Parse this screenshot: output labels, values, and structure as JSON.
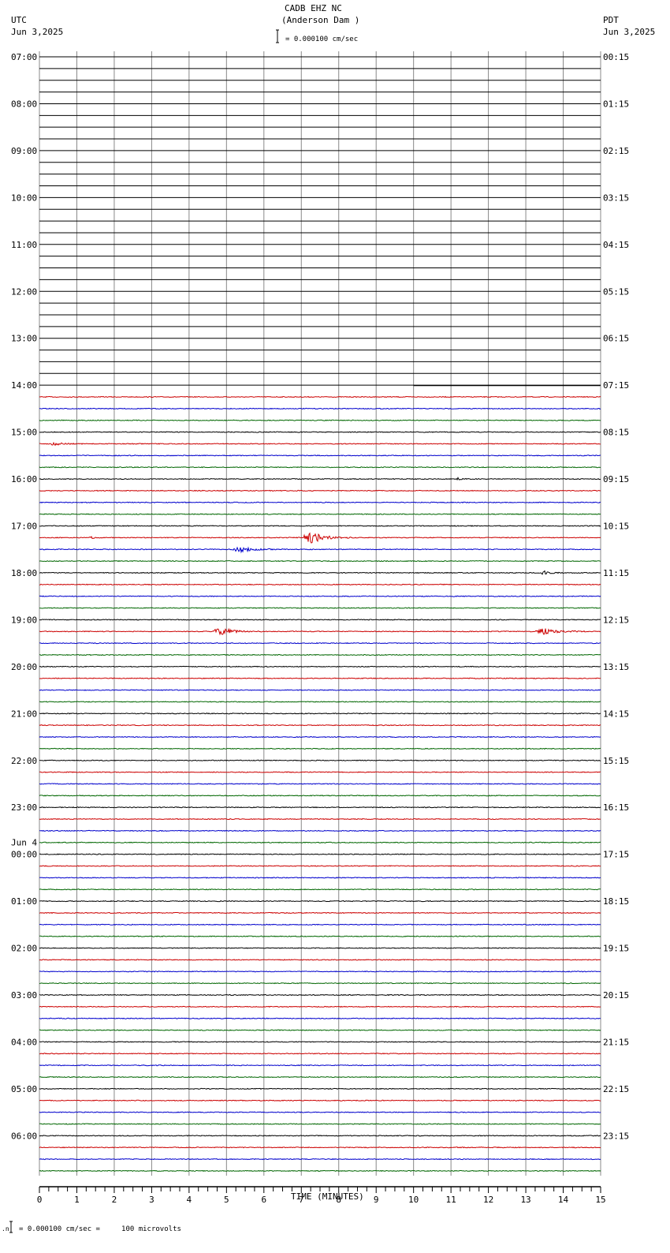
{
  "header": {
    "station": "CADB EHZ NC",
    "location": "(Anderson Dam )",
    "left_tz": "UTC",
    "left_date": "Jun 3,2025",
    "right_tz": "PDT",
    "right_date": "Jun 3,2025",
    "scale": "= 0.000100 cm/sec"
  },
  "footer": {
    "scale": "= 0.000100 cm/sec =     100 microvolts",
    "x_label": "TIME (MINUTES)"
  },
  "chart_data": {
    "type": "line",
    "title": "CADB EHZ NC (Anderson Dam )",
    "xlabel": "TIME (MINUTES)",
    "xlim": [
      0,
      15
    ],
    "x_ticks": [
      "0",
      "1",
      "2",
      "3",
      "4",
      "5",
      "6",
      "7",
      "8",
      "9",
      "10",
      "11",
      "12",
      "13",
      "14",
      "15"
    ],
    "utc_labels": [
      "07:00",
      "08:00",
      "09:00",
      "10:00",
      "11:00",
      "12:00",
      "13:00",
      "14:00",
      "15:00",
      "16:00",
      "17:00",
      "18:00",
      "19:00",
      "20:00",
      "21:00",
      "22:00",
      "23:00",
      "00:00",
      "01:00",
      "02:00",
      "03:00",
      "04:00",
      "05:00",
      "06:00"
    ],
    "date_change_label": "Jun 4",
    "pdt_labels": [
      "00:15",
      "01:15",
      "02:15",
      "03:15",
      "04:15",
      "05:15",
      "06:15",
      "07:15",
      "08:15",
      "09:15",
      "10:15",
      "11:15",
      "12:15",
      "13:15",
      "14:15",
      "15:15",
      "16:15",
      "17:15",
      "18:15",
      "19:15",
      "20:15",
      "21:15",
      "22:15",
      "23:15"
    ],
    "traces_per_hour": 4,
    "trace_colors": [
      "#000000",
      "#cc0000",
      "#0000cc",
      "#006600"
    ],
    "data_start": {
      "row": 28,
      "minute": 10
    },
    "events": [
      {
        "row": 33,
        "minute": 0.4,
        "amplitude": 4,
        "duration": 0.5
      },
      {
        "row": 33,
        "minute": 2.4,
        "amplitude": 2,
        "duration": 0.2
      },
      {
        "row": 36,
        "minute": 11.2,
        "amplitude": 3,
        "duration": 0.3
      },
      {
        "row": 41,
        "minute": 1.4,
        "amplitude": 2,
        "duration": 0.2
      },
      {
        "row": 41,
        "minute": 7.3,
        "amplitude": 14,
        "duration": 0.8
      },
      {
        "row": 42,
        "minute": 5.4,
        "amplitude": 6,
        "duration": 0.8
      },
      {
        "row": 44,
        "minute": 13.5,
        "amplitude": 6,
        "duration": 0.3
      },
      {
        "row": 49,
        "minute": 4.9,
        "amplitude": 8,
        "duration": 0.8
      },
      {
        "row": 49,
        "minute": 13.5,
        "amplitude": 8,
        "duration": 0.8
      }
    ]
  }
}
